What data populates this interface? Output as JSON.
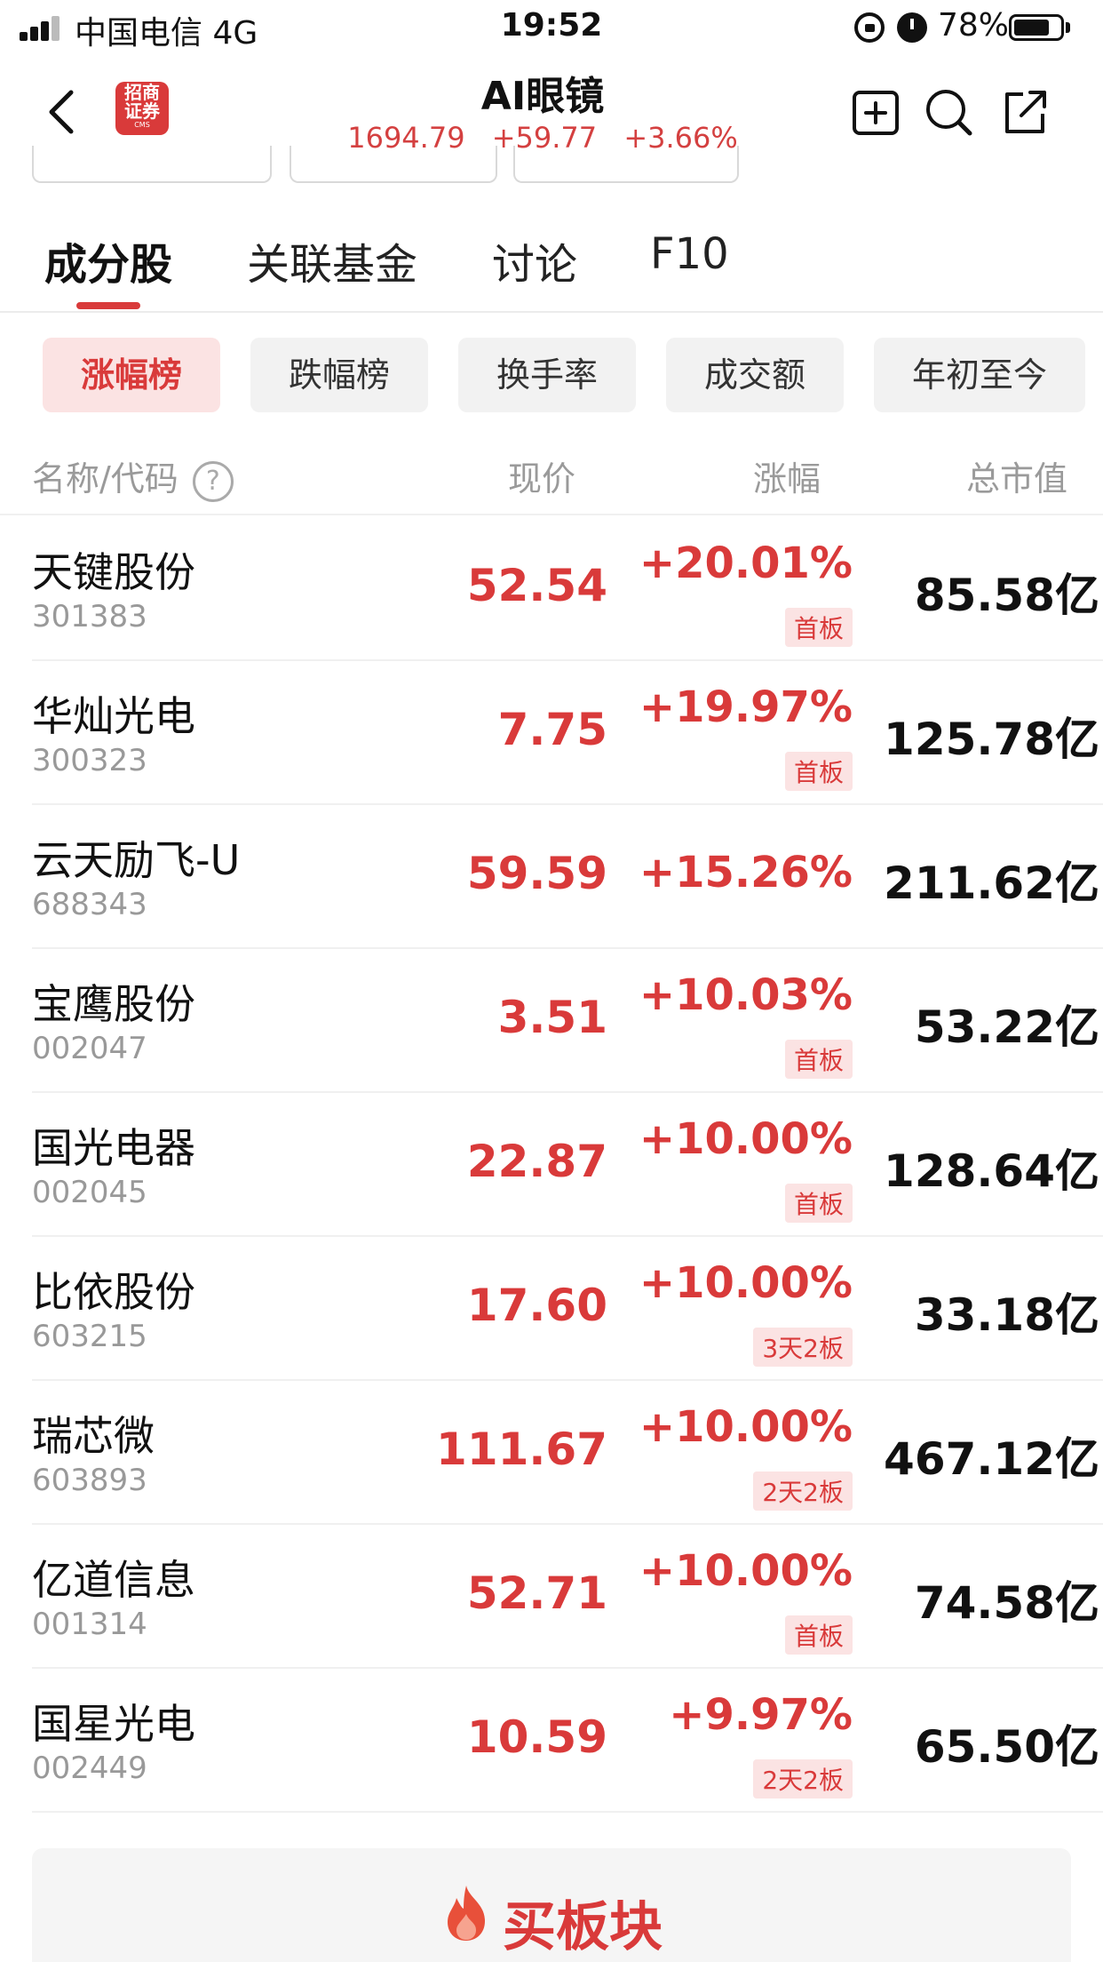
{
  "status_bar": {
    "carrier": "中国电信   4G",
    "time": "19:52",
    "battery_pct": "78%",
    "battery_level": 0.78,
    "icons": [
      "signal-icon",
      "rotation-lock-icon",
      "alarm-icon",
      "battery-icon"
    ]
  },
  "header": {
    "title": "AI眼镜",
    "logo_line1": "招商",
    "logo_line2": "证券",
    "logo_sub": "CMS",
    "quote": {
      "price": "1694.79",
      "change": "+59.77",
      "change_pct": "+3.66%"
    },
    "icons": [
      "back-icon",
      "add-watchlist-icon",
      "search-icon",
      "share-icon"
    ]
  },
  "tabs": [
    {
      "label": "成分股",
      "active": true
    },
    {
      "label": "关联基金",
      "active": false
    },
    {
      "label": "讨论",
      "active": false
    },
    {
      "label": "F10",
      "active": false
    }
  ],
  "chips": [
    {
      "label": "涨幅榜",
      "active": true
    },
    {
      "label": "跌幅榜",
      "active": false
    },
    {
      "label": "换手率",
      "active": false
    },
    {
      "label": "成交额",
      "active": false
    },
    {
      "label": "年初至今",
      "active": false
    }
  ],
  "table": {
    "headers": {
      "name": "名称/代码",
      "price": "现价",
      "change": "涨幅",
      "cap": "总市值"
    },
    "rows": [
      {
        "name": "天键股份",
        "code": "301383",
        "price": "52.54",
        "change": "+20.01%",
        "badge": "首板",
        "cap": "85.58亿"
      },
      {
        "name": "华灿光电",
        "code": "300323",
        "price": "7.75",
        "change": "+19.97%",
        "badge": "首板",
        "cap": "125.78亿"
      },
      {
        "name": "云天励飞-U",
        "code": "688343",
        "price": "59.59",
        "change": "+15.26%",
        "badge": "",
        "cap": "211.62亿"
      },
      {
        "name": "宝鹰股份",
        "code": "002047",
        "price": "3.51",
        "change": "+10.03%",
        "badge": "首板",
        "cap": "53.22亿"
      },
      {
        "name": "国光电器",
        "code": "002045",
        "price": "22.87",
        "change": "+10.00%",
        "badge": "首板",
        "cap": "128.64亿"
      },
      {
        "name": "比依股份",
        "code": "603215",
        "price": "17.60",
        "change": "+10.00%",
        "badge": "3天2板",
        "cap": "33.18亿"
      },
      {
        "name": "瑞芯微",
        "code": "603893",
        "price": "111.67",
        "change": "+10.00%",
        "badge": "2天2板",
        "cap": "467.12亿"
      },
      {
        "name": "亿道信息",
        "code": "001314",
        "price": "52.71",
        "change": "+10.00%",
        "badge": "首板",
        "cap": "74.58亿"
      },
      {
        "name": "国星光电",
        "code": "002449",
        "price": "10.59",
        "change": "+9.97%",
        "badge": "2天2板",
        "cap": "65.50亿"
      }
    ]
  },
  "bottom": {
    "label": "买板块",
    "icon": "flame-icon"
  },
  "colors": {
    "accent": "#d93a3a",
    "chip_active_bg": "#fbe3e3",
    "chip_bg": "#f2f2f2"
  }
}
